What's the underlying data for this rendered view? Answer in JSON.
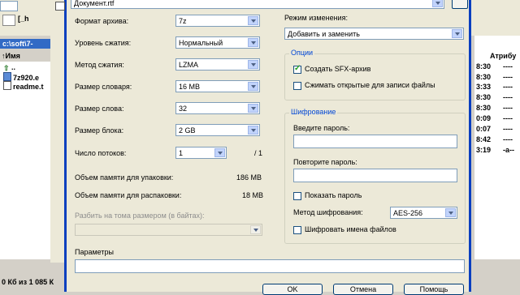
{
  "file_manager": {
    "path": "c:\\soft\\7-",
    "column_name": "Имя",
    "column_attr": "Атрибу",
    "files": [
      "..",
      "7z920.e",
      "readme.t"
    ],
    "times": [
      "8:30",
      "8:30",
      "3:33",
      "8:30",
      "8:30",
      "0:09",
      "0:07",
      "8:42",
      "3:19"
    ],
    "attrs": [
      "----",
      "----",
      "----",
      "----",
      "----",
      "----",
      "----",
      "----",
      "-a--"
    ],
    "status": "0 Кб из 1 085 К"
  },
  "dialog": {
    "archive_name": "Документ.rtf",
    "format_label": "Формат архива:",
    "format_value": "7z",
    "level_label": "Уровень сжатия:",
    "level_value": "Нормальный",
    "method_label": "Метод сжатия:",
    "method_value": "LZMA",
    "dict_label": "Размер словаря:",
    "dict_value": "16 MB",
    "word_label": "Размер слова:",
    "word_value": "32",
    "block_label": "Размер блока:",
    "block_value": "2 GB",
    "threads_label": "Число потоков:",
    "threads_value": "1",
    "threads_max": "/ 1",
    "mem_pack_label": "Объем памяти для упаковки:",
    "mem_pack_value": "186 MB",
    "mem_unpack_label": "Объем памяти для распаковки:",
    "mem_unpack_value": "18 MB",
    "split_label": "Разбить на тома размером (в байтах):",
    "params_label": "Параметры",
    "update_mode_label": "Режим изменения:",
    "update_mode_value": "Добавить и заменить",
    "options_title": "Опции",
    "sfx_label": "Создать SFX-архив",
    "sfx_checked": true,
    "shared_label": "Сжимать открытые для записи файлы",
    "shared_checked": false,
    "encryption_title": "Шифрование",
    "password_label": "Введите пароль:",
    "password_repeat_label": "Повторите пароль:",
    "show_password_label": "Показать пароль",
    "show_password_checked": false,
    "enc_method_label": "Метод шифрования:",
    "enc_method_value": "AES-256",
    "encrypt_names_label": "Шифровать имена файлов",
    "encrypt_names_checked": false,
    "ok_label": "OK",
    "cancel_label": "Отмена",
    "help_label": "Помощь"
  }
}
